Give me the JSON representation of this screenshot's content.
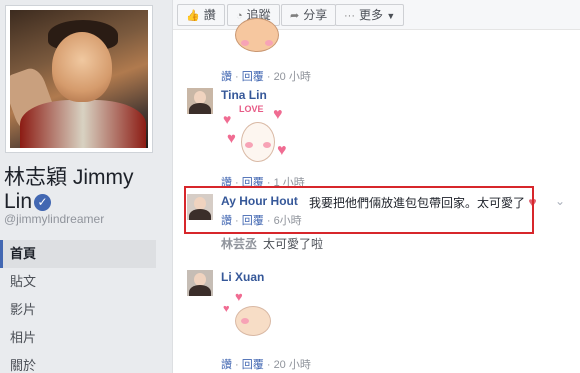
{
  "page": {
    "name": "林志穎 Jimmy Lin",
    "handle": "@jimmylindreamer",
    "verified": true,
    "nav": [
      {
        "label": "首頁",
        "active": true
      },
      {
        "label": "貼文",
        "active": false
      },
      {
        "label": "影片",
        "active": false
      },
      {
        "label": "相片",
        "active": false
      },
      {
        "label": "關於",
        "active": false
      }
    ]
  },
  "actions": {
    "like": "讚",
    "follow": "追蹤",
    "share": "分享",
    "more": "更多"
  },
  "comments": [
    {
      "author": "",
      "text": "",
      "like": "讚",
      "reply": "回覆",
      "time": "20 小時"
    },
    {
      "author": "Tina Lin",
      "text": "",
      "sticker_text": "LOVE",
      "like": "讚",
      "reply": "回覆",
      "time": "1 小時"
    },
    {
      "author": "Ay Hour Hout",
      "text": "我要把他們倆放進包包帶回家。太可愛了",
      "like": "讚",
      "reply": "回覆",
      "time": "6小時",
      "highlighted": true
    },
    {
      "author": "林芸丞",
      "text": "太可愛了啦",
      "like": "",
      "reply": "",
      "time": ""
    },
    {
      "author": "Li Xuan",
      "text": "",
      "like": "讚",
      "reply": "回覆",
      "time": "20 小時"
    }
  ],
  "colors": {
    "link": "#365899",
    "highlight": "#d7262b",
    "heart": "#f06c92",
    "verified": "#4267b2"
  }
}
